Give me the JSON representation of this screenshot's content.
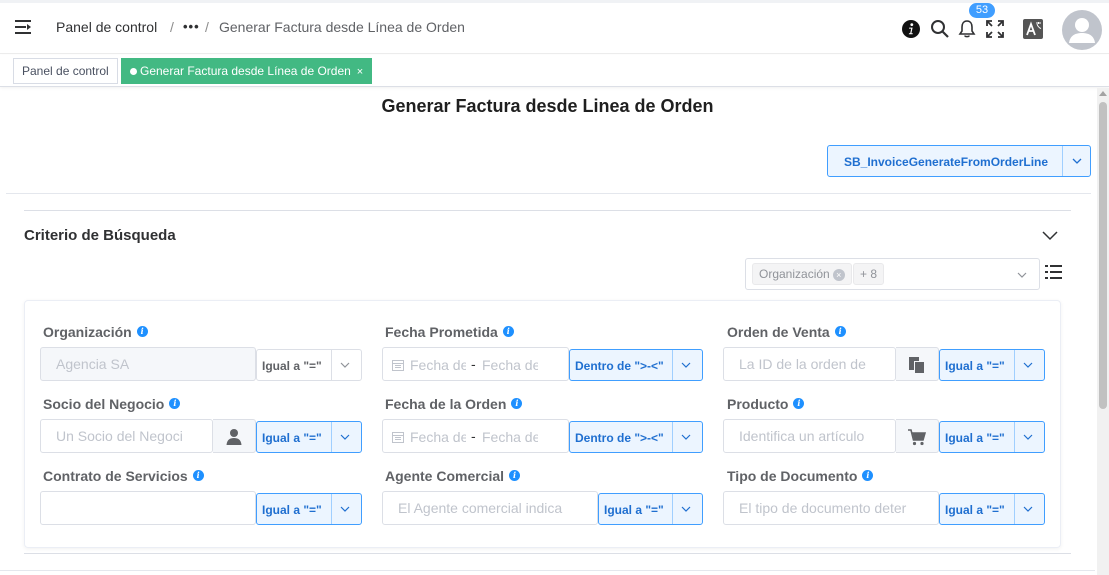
{
  "header": {
    "breadcrumb": {
      "home": "Panel de control",
      "separator": "/",
      "ellipsis": "•••",
      "current": "Generar Factura desde Línea de Orden"
    },
    "notifications_count": "53",
    "icons": [
      "menu-toggle-icon",
      "info-icon",
      "search-icon",
      "bell-icon",
      "fullscreen-icon",
      "translate-icon",
      "user-avatar-icon"
    ]
  },
  "tabs": [
    {
      "label": "Panel de control",
      "active": false
    },
    {
      "label": "Generar Factura desde Línea de Orden",
      "active": true,
      "close": "×"
    }
  ],
  "page": {
    "title": "Generar Factura desde Linea de Orden",
    "process_button": "SB_InvoiceGenerateFromOrderLine"
  },
  "search": {
    "title": "Criterio de Búsqueda",
    "field_tags": [
      "Organización",
      "+ 8"
    ],
    "fields": {
      "organization": {
        "label": "Organización",
        "value": "Agencia SA",
        "operator": "Igual a \"=\""
      },
      "promised_date": {
        "label": "Fecha Prometida",
        "start_placeholder": "Fecha de",
        "end_placeholder": "Fecha de",
        "operator": "Dentro de \">-<\""
      },
      "sales_order": {
        "label": "Orden de Venta",
        "placeholder": "La ID de la orden de",
        "operator": "Igual a \"=\""
      },
      "business_partner": {
        "label": "Socio del Negocio",
        "placeholder": "Un Socio del Negoci",
        "operator": "Igual a \"=\""
      },
      "order_date": {
        "label": "Fecha de la Orden",
        "start_placeholder": "Fecha de",
        "end_placeholder": "Fecha de",
        "operator": "Dentro de \">-<\""
      },
      "product": {
        "label": "Producto",
        "placeholder": "Identifica un artículo",
        "operator": "Igual a \"=\""
      },
      "service_contract": {
        "label": "Contrato de Servicios",
        "value": "",
        "operator": "Igual a \"=\""
      },
      "sales_agent": {
        "label": "Agente Comercial",
        "placeholder": "El Agente comercial indica",
        "operator": "Igual a \"=\""
      },
      "document_type": {
        "label": "Tipo de Documento",
        "placeholder": "El tipo de documento deter",
        "operator": "Igual a \"=\""
      }
    }
  },
  "colors": {
    "accent": "#409eff",
    "active_tab": "#42b983",
    "badge": "#409eff"
  }
}
